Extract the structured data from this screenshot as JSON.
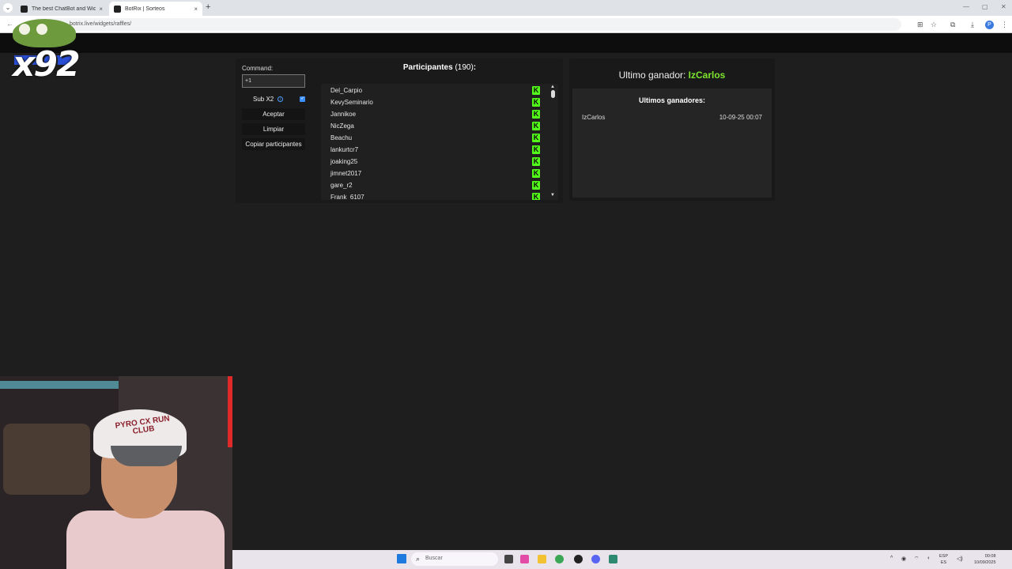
{
  "browser": {
    "tabs": [
      {
        "title": "The best ChatBot and Widgets",
        "active": false
      },
      {
        "title": "BotRix | Sorteos",
        "active": true
      }
    ],
    "url": "botrix.live/widgets/raffles/",
    "new_tab": "+",
    "close_glyph": "×",
    "window_controls": [
      "—",
      "▢",
      "✕"
    ],
    "profile_initial": "P"
  },
  "overlay": {
    "logo_text": "x92"
  },
  "raffle": {
    "command_label": "Command:",
    "command_value": "+1",
    "sub_x2_label": "Sub X2",
    "sub_x2_checked": true,
    "accept_label": "Aceptar",
    "clear_label": "Limpiar",
    "copy_label": "Copiar participantes",
    "participants_title": "Participantes",
    "participants_count": "(190)",
    "participants_colon": ":",
    "participants": [
      "Del_Carpio",
      "KevySeminario",
      "Jannikoe",
      "NicZega",
      "Beachu",
      "lankurtcr7",
      "joaking25",
      "jimnet2017",
      "gare_r2",
      "Frank_6107"
    ],
    "platform_badge": "K",
    "platform_color": "#53fc18"
  },
  "winner": {
    "last_winner_label": "Ultimo ganador: ",
    "last_winner_name": "IzCarlos",
    "winner_color": "#7ee52f",
    "history_title": "Ultimos ganadores:",
    "history": [
      {
        "name": "IzCarlos",
        "time": "10-09-25 00:07"
      }
    ]
  },
  "webcam": {
    "cap_text": "PYRO CX RUN CLUB"
  },
  "taskbar": {
    "search_placeholder": "Buscar",
    "lang_top": "ESP",
    "lang_bottom": "ES",
    "time": "00:08",
    "date": "10/09/2025"
  }
}
